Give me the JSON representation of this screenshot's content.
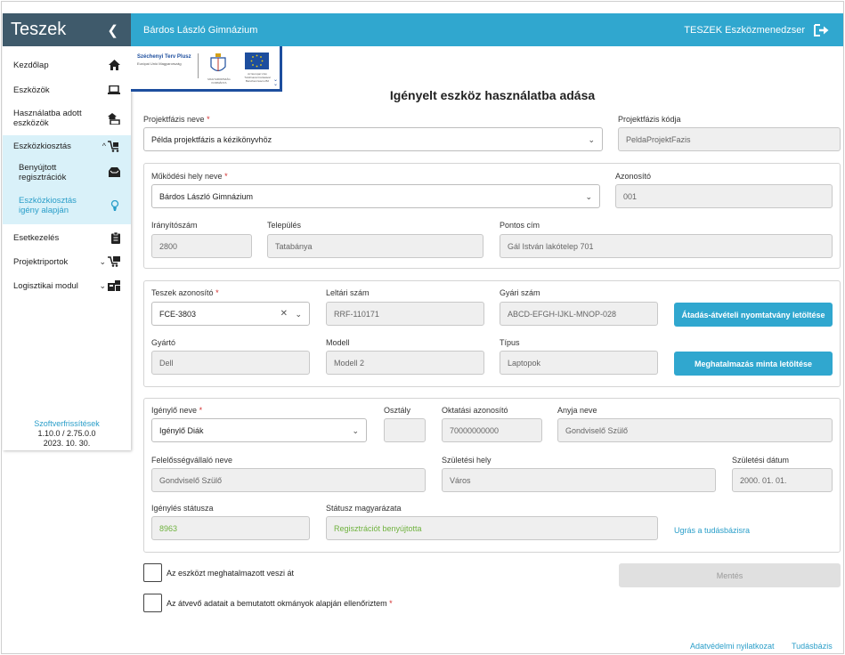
{
  "sidebar": {
    "title": "Teszek",
    "collapse_icon": "chevron-left-icon",
    "items": [
      {
        "label": "Kezdőlap",
        "icon": "home-icon"
      },
      {
        "label": "Eszközök",
        "icon": "laptop-icon"
      },
      {
        "label": "Használatba adott eszközök",
        "icon": "handover-icon"
      },
      {
        "label": "Eszközkiosztás",
        "icon": "cart-icon"
      },
      {
        "label": "Benyújtott regisztrációk",
        "icon": "inbox-icon"
      },
      {
        "label": "Eszközkiosztás igény alapján",
        "icon": "bulb-hand-icon"
      },
      {
        "label": "Esetkezelés",
        "icon": "clipboard-icon"
      },
      {
        "label": "Projektriportok",
        "icon": "report-icon"
      },
      {
        "label": "Logisztikai modul",
        "icon": "logistics-icon"
      }
    ],
    "footer": {
      "link": "Szoftverfrissítések",
      "version": "1.10.0 / 2.75.0.0",
      "date": "2023. 10. 30."
    }
  },
  "topbar": {
    "school": "Bárdos László Gimnázium",
    "app_name": "TESZEK Eszközmenedzser",
    "logout_icon": "logout-icon"
  },
  "banner": {
    "szechenyi": "Széchenyi Terv Plusz",
    "szechenyi_small": "Európai Unió Magyarország",
    "crest_text": "MAGYARORSZÁG KORMÁNYA",
    "eu_text": "Az Európai Unió Társfinanszírozásával Baruthenzsavnu B2"
  },
  "page_title": "Igényelt eszköz használatba adása",
  "projekt": {
    "phase_label": "Projektfázis neve",
    "phase_value": "Példa projektfázis a kézikönyvhöz",
    "code_label": "Projektfázis kódja",
    "code_value": "PeldaProjektFazis"
  },
  "site": {
    "name_label": "Működési hely neve",
    "name_value": "Bárdos László Gimnázium",
    "id_label": "Azonosító",
    "id_value": "001",
    "zip_label": "Irányítószám",
    "zip_value": "2800",
    "city_label": "Település",
    "city_value": "Tatabánya",
    "address_label": "Pontos cím",
    "address_value": "Gál István lakótelep 701"
  },
  "device": {
    "teszek_label": "Teszek azonosító",
    "teszek_value": "FCE-3803",
    "inv_label": "Leltári szám",
    "inv_value": "RRF-110171",
    "serial_label": "Gyári szám",
    "serial_value": "ABCD-EFGH-IJKL-MNOP-028",
    "btn_download_form": "Átadás-átvételi nyomtatvány letöltése",
    "maker_label": "Gyártó",
    "maker_value": "Dell",
    "model_label": "Modell",
    "model_value": "Modell 2",
    "type_label": "Típus",
    "type_value": "Laptopok",
    "btn_download_auth": "Meghatalmazás minta letöltése"
  },
  "requester": {
    "name_label": "Igénylő neve",
    "name_value": "Igénylő Diák",
    "class_label": "Osztály",
    "class_value": "",
    "edu_label": "Oktatási azonosító",
    "edu_value": "70000000000",
    "mother_label": "Anyja neve",
    "mother_value": "Gondviselő Szülő",
    "guardian_label": "Felelősségvállaló neve",
    "guardian_value": "Gondviselő Szülő",
    "birthplace_label": "Születési hely",
    "birthplace_value": "Város",
    "birthdate_label": "Születési dátum",
    "birthdate_value": "2000. 01. 01.",
    "status_label": "Igénylés státusza",
    "status_value": "8963",
    "status_desc_label": "Státusz magyarázata",
    "status_desc_value": "Regisztrációt benyújtotta",
    "kb_link": "Ugrás a tudásbázisra"
  },
  "checks": {
    "proxy_label": "Az eszközt meghatalmazott veszi át",
    "verified_label": "Az átvevő adatait a bemutatott okmányok alapján ellenőriztem"
  },
  "save_label": "Mentés",
  "footer": {
    "privacy": "Adatvédelmi nyilatkozat",
    "kb": "Tudásbázis"
  },
  "colors": {
    "accent": "#30a7cf",
    "sidebar_head": "#3f5a6b",
    "active_bg": "#d9f1f9",
    "status_green": "#6fb23e",
    "required": "#d32f2f"
  }
}
